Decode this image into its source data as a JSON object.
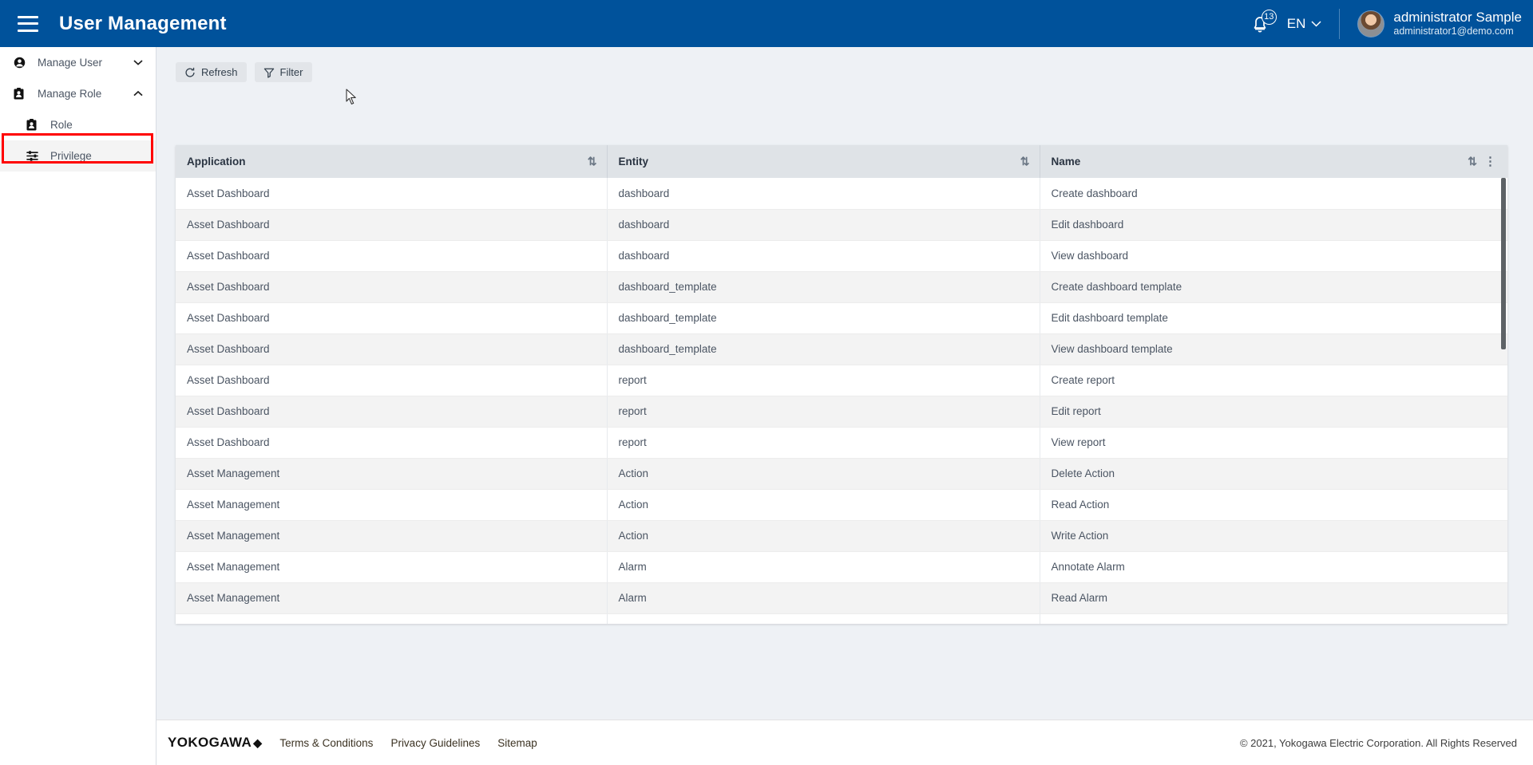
{
  "header": {
    "menu_icon": "hamburger-icon",
    "title": "User Management",
    "notification_icon": "bell-icon",
    "notification_count": "13",
    "language": "EN",
    "chevron_icon": "chevron-down-icon",
    "user_name": "administrator Sample",
    "user_email": "administrator1@demo.com",
    "brand_color": "#00529b"
  },
  "sidebar": {
    "items": [
      {
        "label": "Manage User",
        "icon": "user-circle-icon",
        "chevron": "chevron-down-icon",
        "expanded": false
      },
      {
        "label": "Manage Role",
        "icon": "id-badge-icon",
        "chevron": "chevron-up-icon",
        "expanded": true
      }
    ],
    "sub_items": [
      {
        "label": "Role",
        "icon": "id-badge-icon",
        "active": false
      },
      {
        "label": "Privilege",
        "icon": "sliders-icon",
        "active": true
      }
    ],
    "highlight_color": "#ff0000"
  },
  "toolbar": {
    "refresh_label": "Refresh",
    "refresh_icon": "refresh-icon",
    "filter_label": "Filter",
    "filter_icon": "funnel-icon"
  },
  "table": {
    "columns": [
      {
        "label": "Application",
        "sort_icon": "sort-icon"
      },
      {
        "label": "Entity",
        "sort_icon": "sort-icon"
      },
      {
        "label": "Name",
        "sort_icon": "sort-icon",
        "menu_icon": "kebab-menu-icon"
      }
    ],
    "rows": [
      {
        "application": "Asset Dashboard",
        "entity": "dashboard",
        "name": "Create dashboard"
      },
      {
        "application": "Asset Dashboard",
        "entity": "dashboard",
        "name": "Edit dashboard"
      },
      {
        "application": "Asset Dashboard",
        "entity": "dashboard",
        "name": "View dashboard"
      },
      {
        "application": "Asset Dashboard",
        "entity": "dashboard_template",
        "name": "Create dashboard template"
      },
      {
        "application": "Asset Dashboard",
        "entity": "dashboard_template",
        "name": "Edit dashboard template"
      },
      {
        "application": "Asset Dashboard",
        "entity": "dashboard_template",
        "name": "View dashboard template"
      },
      {
        "application": "Asset Dashboard",
        "entity": "report",
        "name": "Create report"
      },
      {
        "application": "Asset Dashboard",
        "entity": "report",
        "name": "Edit report"
      },
      {
        "application": "Asset Dashboard",
        "entity": "report",
        "name": "View report"
      },
      {
        "application": "Asset Management",
        "entity": "Action",
        "name": "Delete Action"
      },
      {
        "application": "Asset Management",
        "entity": "Action",
        "name": "Read Action"
      },
      {
        "application": "Asset Management",
        "entity": "Action",
        "name": "Write Action"
      },
      {
        "application": "Asset Management",
        "entity": "Alarm",
        "name": "Annotate Alarm"
      },
      {
        "application": "Asset Management",
        "entity": "Alarm",
        "name": "Read Alarm"
      },
      {
        "application": "",
        "entity": "",
        "name": ""
      }
    ]
  },
  "footer": {
    "brand": "YOKOGAWA",
    "brand_mark": "◆",
    "links": [
      "Terms & Conditions",
      "Privacy Guidelines",
      "Sitemap"
    ],
    "copyright": "© 2021, Yokogawa Electric Corporation. All Rights Reserved"
  }
}
